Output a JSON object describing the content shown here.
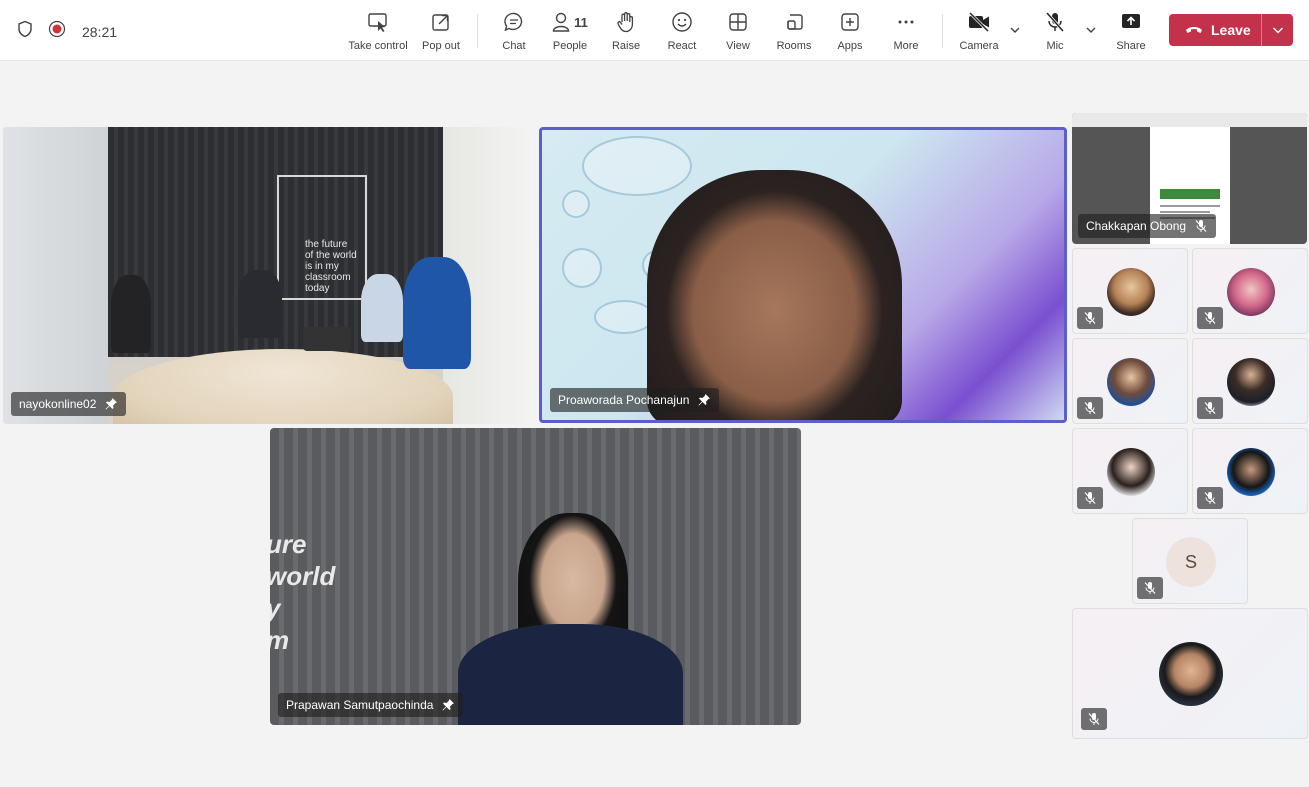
{
  "call": {
    "timer": "28:21"
  },
  "toolbar": {
    "take_control": "Take control",
    "pop_out": "Pop out",
    "chat": "Chat",
    "people": "People",
    "people_count": "11",
    "raise": "Raise",
    "react": "React",
    "view": "View",
    "rooms": "Rooms",
    "apps": "Apps",
    "more": "More",
    "camera": "Camera",
    "mic": "Mic",
    "share": "Share",
    "leave": "Leave"
  },
  "stage": {
    "tiles": [
      {
        "name": "nayokonline02",
        "pinned": true
      },
      {
        "name": "Proaworada Pochanajun",
        "pinned": true,
        "active_speaker": true
      },
      {
        "name": "Prapawan Samutpaochinda",
        "pinned": true
      }
    ],
    "room_poster": [
      "the future",
      "of the world",
      "is in my",
      "classroom",
      "today"
    ],
    "studio_wall": [
      "ure",
      "world",
      "y",
      "m"
    ]
  },
  "sidebar": {
    "share_tile": {
      "name": "Chakkapan Obong",
      "muted": true
    },
    "initial_tile": {
      "initial": "S",
      "muted": true
    }
  },
  "colors": {
    "accent": "#5b5fc7",
    "leave": "#c4314b",
    "record": "#d13438"
  }
}
